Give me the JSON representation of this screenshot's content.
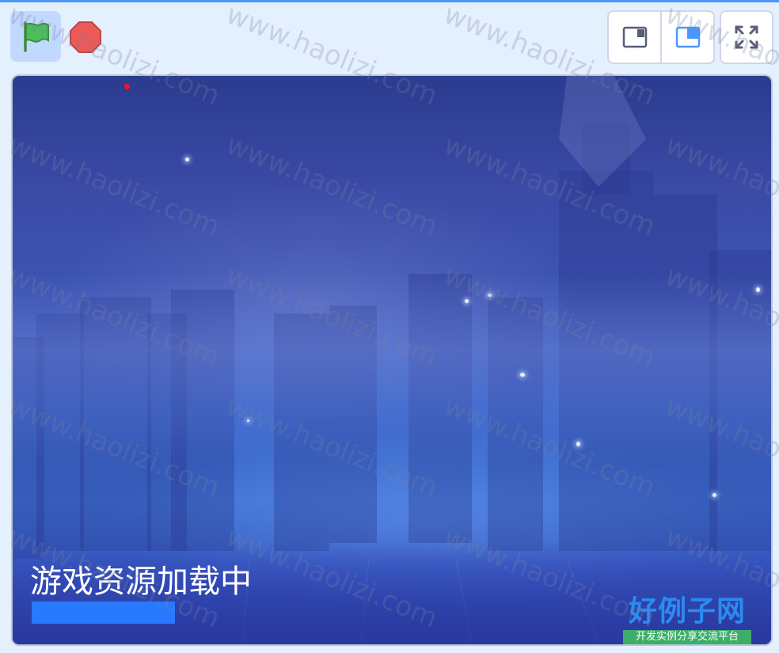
{
  "toolbar": {
    "green_flag": {
      "icon": "green-flag-icon",
      "color": "#4cbf56"
    },
    "stop": {
      "icon": "stop-sign-icon",
      "color": "#ec5959"
    },
    "layout_small": {
      "icon": "small-stage-icon",
      "selected": false
    },
    "layout_normal": {
      "icon": "normal-stage-icon",
      "selected": true
    },
    "fullscreen": {
      "icon": "fullscreen-icon"
    }
  },
  "stage": {
    "loading_text": "游戏资源加载中",
    "progress": 0.2,
    "colors": {
      "progress": "#2979ff",
      "accent": "#4c97ff"
    }
  },
  "logo": {
    "main": "好例子网",
    "sub": "开发实例分享交流平台"
  },
  "watermark": {
    "text": "www.haolizi.com"
  }
}
